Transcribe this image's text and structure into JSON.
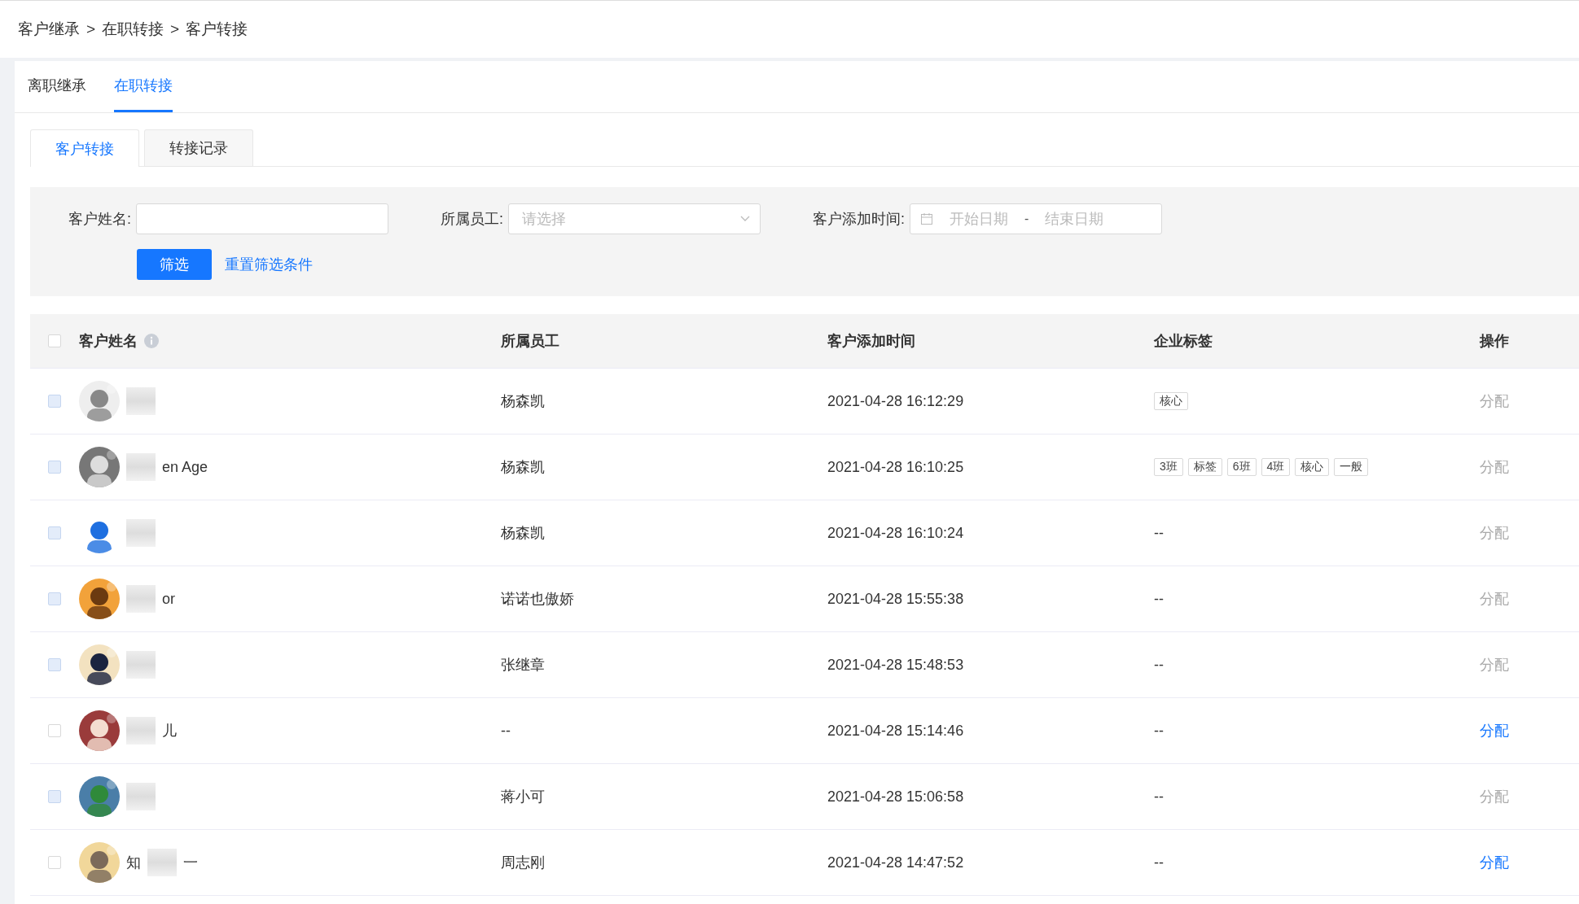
{
  "breadcrumb": [
    {
      "label": "客户继承"
    },
    {
      "label": "在职转接"
    },
    {
      "label": "客户转接"
    }
  ],
  "breadcrumb_separator": ">",
  "tabs": [
    {
      "label": "离职继承",
      "selected": false
    },
    {
      "label": "在职转接",
      "selected": true
    }
  ],
  "card_tabs": [
    {
      "label": "客户转接",
      "selected": true
    },
    {
      "label": "转接记录",
      "selected": false
    }
  ],
  "filters": {
    "name_label": "客户姓名:",
    "employee_label": "所属员工:",
    "employee_placeholder": "请选择",
    "date_label": "客户添加时间:",
    "start_placeholder": "开始日期",
    "date_separator": "-",
    "end_placeholder": "结束日期",
    "submit": "筛选",
    "reset": "重置筛选条件"
  },
  "table": {
    "select_all_checked": false,
    "columns": [
      "客户姓名",
      "所属员工",
      "客户添加时间",
      "企业标签",
      "操作"
    ],
    "rows": [
      {
        "employee": "杨森凯",
        "time": "2021-04-28 16:12:29",
        "tags": [
          "核心"
        ],
        "action": "分配",
        "disabled": true
      },
      {
        "name_after": "en Age",
        "employee": "杨森凯",
        "time": "2021-04-28 16:10:25",
        "tags": [
          "3班",
          "标签",
          "6班",
          "4班",
          "核心",
          "一般"
        ],
        "action": "分配",
        "disabled": true
      },
      {
        "employee": "杨森凯",
        "time": "2021-04-28 16:10:24",
        "empty_tags": "--",
        "action": "分配",
        "disabled": true
      },
      {
        "name_after": "or",
        "employee": "诺诺也傲娇",
        "time": "2021-04-28 15:55:38",
        "empty_tags": "--",
        "action": "分配",
        "disabled": true
      },
      {
        "employee": "张继章",
        "time": "2021-04-28 15:48:53",
        "empty_tags": "--",
        "action": "分配",
        "disabled": true
      },
      {
        "name_after": "儿",
        "employee": "--",
        "time": "2021-04-28 15:14:46",
        "empty_tags": "--",
        "action": "分配",
        "disabled": false
      },
      {
        "employee": "蒋小可",
        "time": "2021-04-28 15:06:58",
        "empty_tags": "--",
        "action": "分配",
        "disabled": true
      },
      {
        "name_before": "知",
        "name_after": "一",
        "employee": "周志刚",
        "time": "2021-04-28 14:47:52",
        "empty_tags": "--",
        "action": "分配",
        "disabled": false
      }
    ]
  }
}
